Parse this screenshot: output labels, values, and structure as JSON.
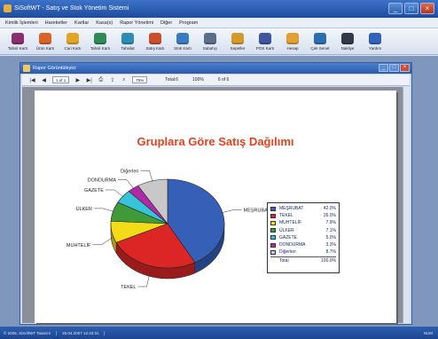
{
  "app": {
    "title": "SiSoftWT - Satış ve Stok Yönetim Sistemi",
    "window_buttons": [
      "_",
      "□",
      "×"
    ]
  },
  "menu": [
    "Kimlik İşlemleri",
    "Hareketler",
    "Kartlar",
    "Kasa(s)",
    "Rapor Yönetimi",
    "Diğer",
    "Program"
  ],
  "toolbar": [
    {
      "label": "Tahsil Kartı",
      "icon": "card-icon",
      "color": "#8b2e6e"
    },
    {
      "label": "Ürün Kartı",
      "icon": "box-icon",
      "color": "#d9632b"
    },
    {
      "label": "Cari Kartı",
      "icon": "person-icon",
      "color": "#e3a526"
    },
    {
      "label": "Tahsil Kartı",
      "icon": "car-icon",
      "color": "#2f8a57"
    },
    {
      "label": "Tahsilat",
      "icon": "invoice-icon",
      "color": "#2d8db5"
    },
    {
      "label": "Satış Kartı",
      "icon": "cart-icon",
      "color": "#c94f2e"
    },
    {
      "label": "Stok Kartı",
      "icon": "globe-icon",
      "color": "#3a7cc4"
    },
    {
      "label": "Sabahçı",
      "icon": "truck-icon",
      "color": "#5b6f8a"
    },
    {
      "label": "Sepetler",
      "icon": "diamond-icon",
      "color": "#d59b2a"
    },
    {
      "label": "POS Kartı",
      "icon": "pos-icon",
      "color": "#3f55a0"
    },
    {
      "label": "Hesap",
      "icon": "folder-icon",
      "color": "#e0a132"
    },
    {
      "label": "Çek Senet",
      "icon": "cheque-icon",
      "color": "#2a6fb0"
    },
    {
      "label": "Nakliye",
      "icon": "truck-dark-icon",
      "color": "#333a47"
    },
    {
      "label": "Yardım",
      "icon": "help-icon",
      "color": "#2f62b8"
    }
  ],
  "report_window": {
    "title": "Rapor Görüntüleyici",
    "page_label": "1 of 1",
    "zoom": "75%",
    "total_label": "Total:6",
    "percent_label": "100%",
    "out_label": "6 of 6"
  },
  "chart_data": {
    "type": "pie",
    "title": "Gruplara Göre Satış Dağılımı",
    "slices": [
      {
        "name": "MEŞRUBAT",
        "value": 42.0,
        "color": "#3660b8"
      },
      {
        "name": "TEKEL",
        "value": 26.0,
        "color": "#dc2626"
      },
      {
        "name": "MUHTELİF",
        "value": 7.9,
        "color": "#f2dc17"
      },
      {
        "name": "ÜLKER",
        "value": 7.1,
        "color": "#3f9a3a"
      },
      {
        "name": "GAZETE",
        "value": 5.0,
        "color": "#37c4d8"
      },
      {
        "name": "DONDURMA",
        "value": 3.3,
        "color": "#b02aa8"
      },
      {
        "name": "Diğerleri",
        "value": 8.7,
        "color": "#c8c8c8"
      }
    ],
    "legend": {
      "position": "right",
      "rows": [
        {
          "name": "MEŞRUBAT",
          "value": "42.0%"
        },
        {
          "name": "TEKEL",
          "value": "26.0%"
        },
        {
          "name": "MUHTELİF",
          "value": "7.9%"
        },
        {
          "name": "ÜLKER",
          "value": "7.1%"
        },
        {
          "name": "GAZETE",
          "value": "5.0%"
        },
        {
          "name": "DONDURMA",
          "value": "3.3%"
        },
        {
          "name": "Diğerleri",
          "value": "8.7%"
        }
      ],
      "total_label": "Total",
      "total_value": "100.0%"
    }
  },
  "statusbar": [
    "© 2005, SiSoftWT Tasarım",
    "25.04.2007 12:43:31",
    "",
    "",
    "NUM"
  ]
}
